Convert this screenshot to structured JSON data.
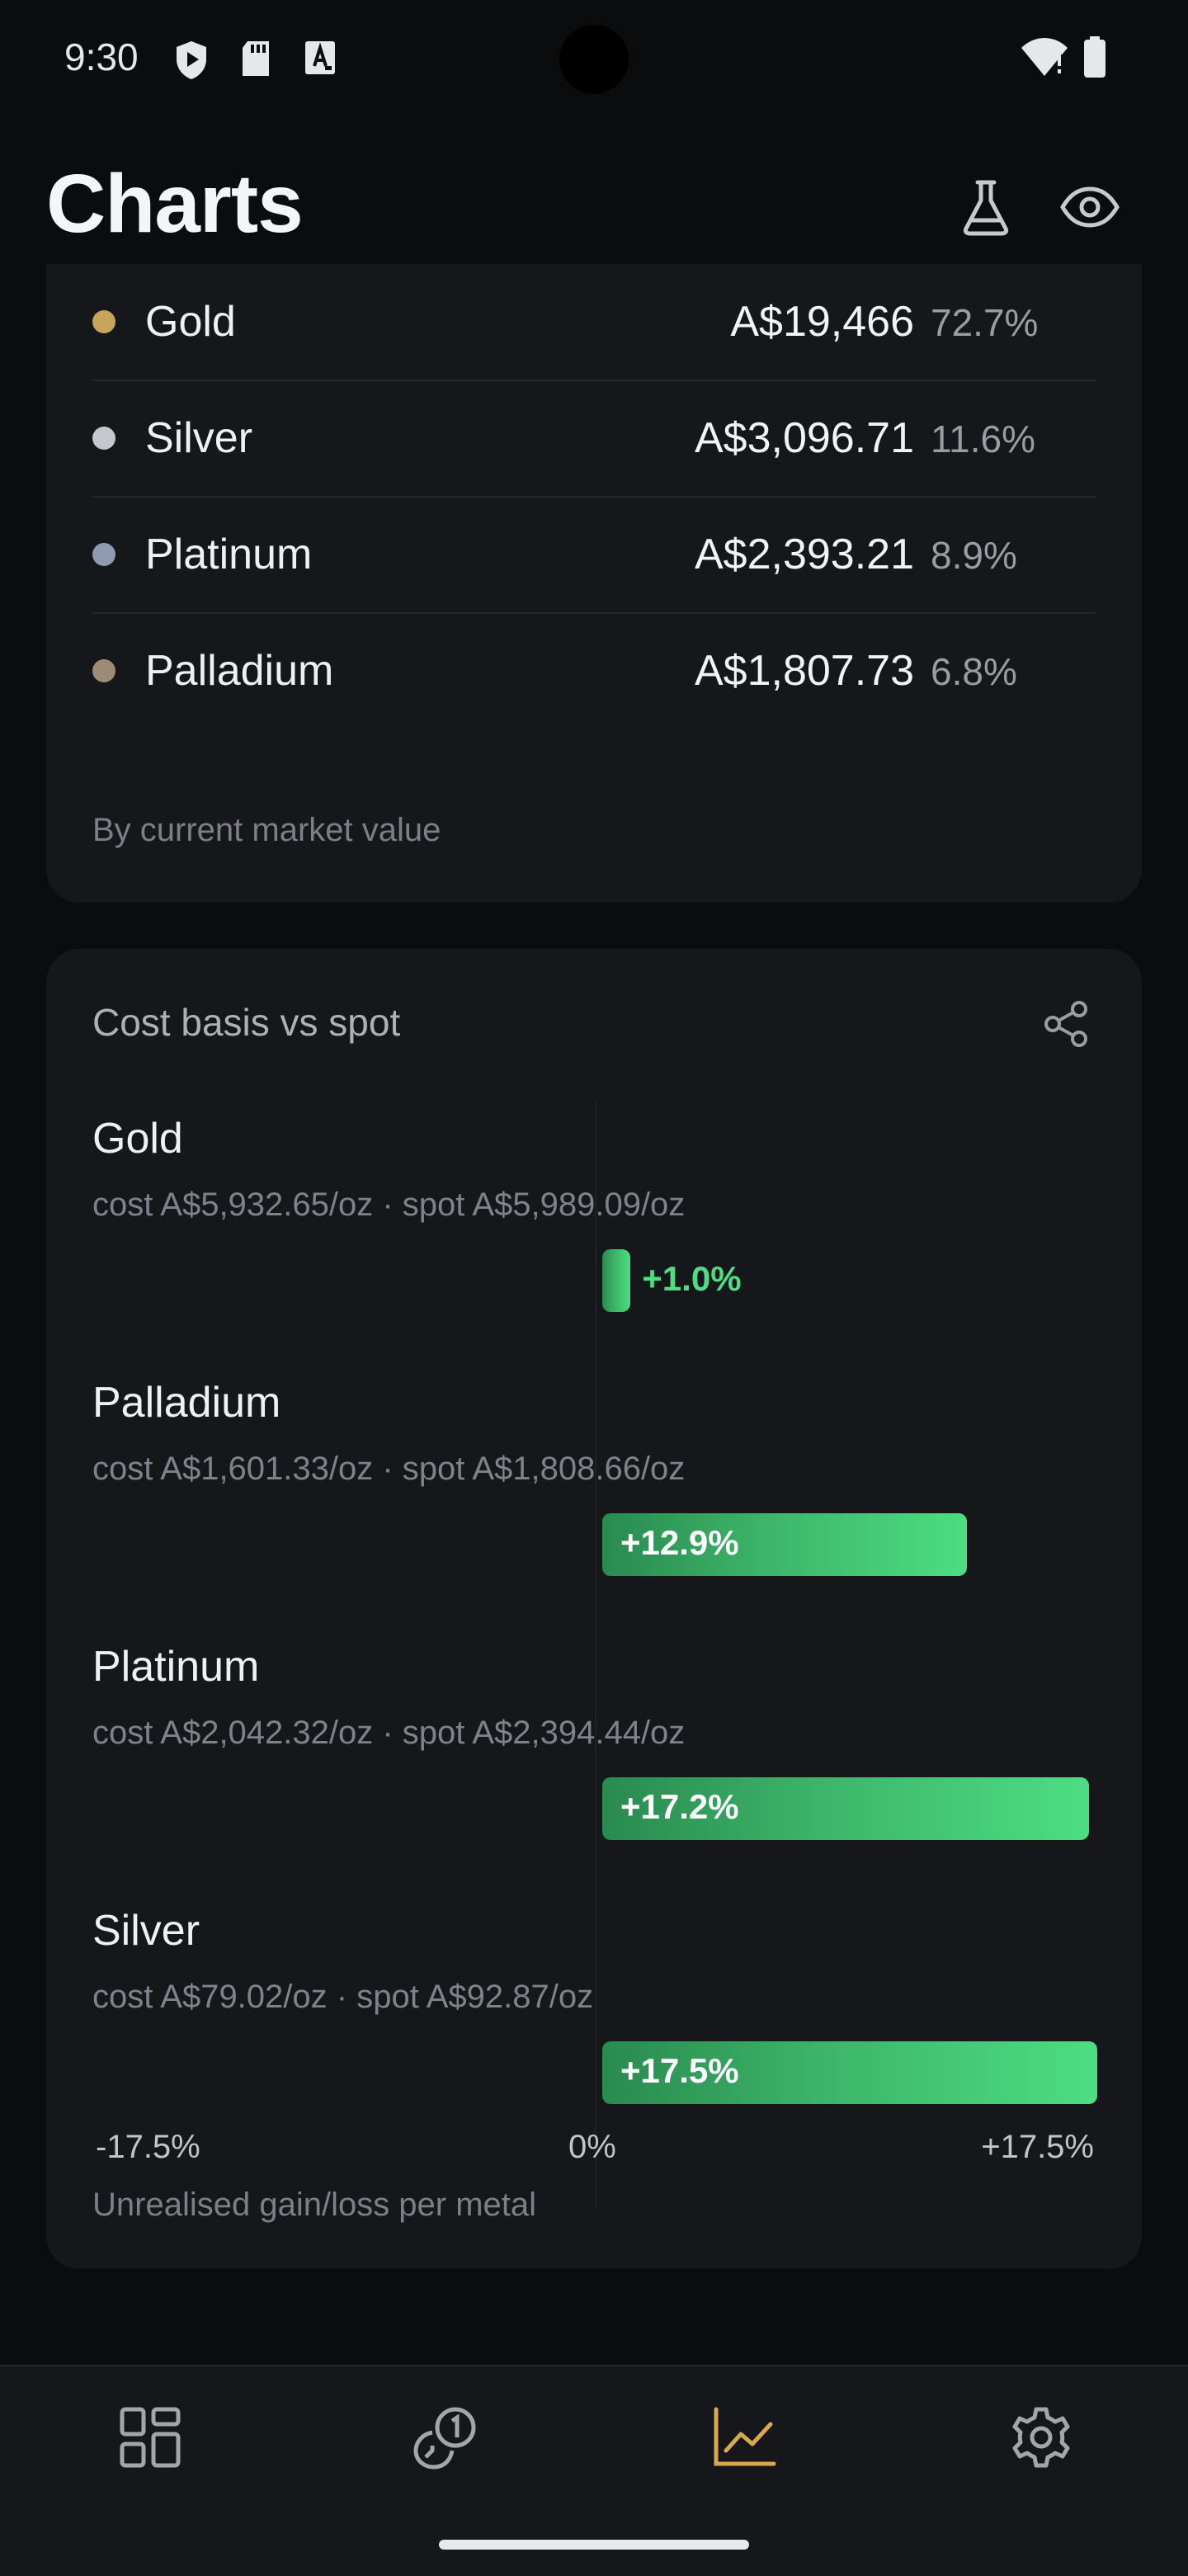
{
  "status_bar": {
    "time": "9:30"
  },
  "header": {
    "title": "Charts",
    "lab_icon": "flask-icon",
    "visibility_icon": "eye-icon"
  },
  "allocation": {
    "items": [
      {
        "name": "Gold",
        "value": "A$19,466",
        "percent": "72.7%",
        "color": "#c9a55a"
      },
      {
        "name": "Silver",
        "value": "A$3,096.71",
        "percent": "11.6%",
        "color": "#c4c7cc"
      },
      {
        "name": "Platinum",
        "value": "A$2,393.21",
        "percent": "8.9%",
        "color": "#8e9bb3"
      },
      {
        "name": "Palladium",
        "value": "A$1,807.73",
        "percent": "6.8%",
        "color": "#9c8c75"
      }
    ],
    "footnote": "By current market value"
  },
  "cost_basis": {
    "title": "Cost basis vs spot",
    "share_icon": "share-icon",
    "rows": [
      {
        "name": "Gold",
        "detail": "cost A$5,932.65/oz · spot A$5,989.09/oz",
        "gain_label": "+1.0%",
        "gain": 1.0
      },
      {
        "name": "Palladium",
        "detail": "cost A$1,601.33/oz · spot A$1,808.66/oz",
        "gain_label": "+12.9%",
        "gain": 12.9
      },
      {
        "name": "Platinum",
        "detail": "cost A$2,042.32/oz · spot A$2,394.44/oz",
        "gain_label": "+17.2%",
        "gain": 17.2
      },
      {
        "name": "Silver",
        "detail": "cost A$79.02/oz · spot A$92.87/oz",
        "gain_label": "+17.5%",
        "gain": 17.5
      }
    ],
    "axis": {
      "min_label": "-17.5%",
      "zero_label": "0%",
      "max_label": "+17.5%",
      "max": 17.5
    },
    "footnote": "Unrealised gain/loss per metal",
    "gain_color": "#4ddd83"
  },
  "nav": {
    "items": [
      {
        "icon": "dashboard-icon",
        "active": false
      },
      {
        "icon": "coins-icon",
        "active": false
      },
      {
        "icon": "chart-icon",
        "active": true
      },
      {
        "icon": "settings-icon",
        "active": false
      }
    ],
    "active_color": "#d8a94f",
    "inactive_color": "#a3a5ab"
  }
}
